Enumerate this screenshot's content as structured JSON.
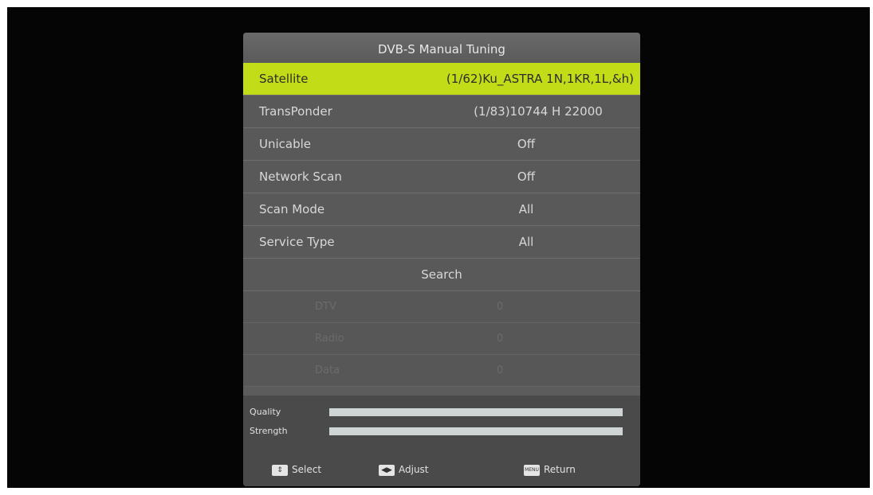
{
  "menu": {
    "title": "DVB-S Manual Tuning",
    "rows": [
      {
        "label": "Satellite",
        "value": "(1/62)Ku_ASTRA 1N,1KR,1L,&h)"
      },
      {
        "label": "TransPonder",
        "value": "(1/83)10744 H 22000"
      },
      {
        "label": "Unicable",
        "value": "Off"
      },
      {
        "label": "Network Scan",
        "value": "Off"
      },
      {
        "label": "Scan Mode",
        "value": "All"
      },
      {
        "label": "Service Type",
        "value": "All"
      }
    ],
    "search_label": "Search",
    "stats": [
      {
        "label": "DTV",
        "value": "0"
      },
      {
        "label": "Radio",
        "value": "0"
      },
      {
        "label": "Data",
        "value": "0"
      }
    ]
  },
  "signal": {
    "quality_label": "Quality",
    "quality_fraction": 1.0,
    "strength_label": "Strength",
    "strength_fraction": 1.0
  },
  "footer": {
    "select": {
      "icon": "up-down-arrow-icon",
      "label": "Select"
    },
    "adjust": {
      "icon": "left-right-arrow-icon",
      "label": "Adjust"
    },
    "return": {
      "icon": "menu-key-icon",
      "key_text": "MENU",
      "label": "Return"
    }
  },
  "colors": {
    "highlight": "#c2dc17",
    "panel": "#5c5c5c"
  }
}
